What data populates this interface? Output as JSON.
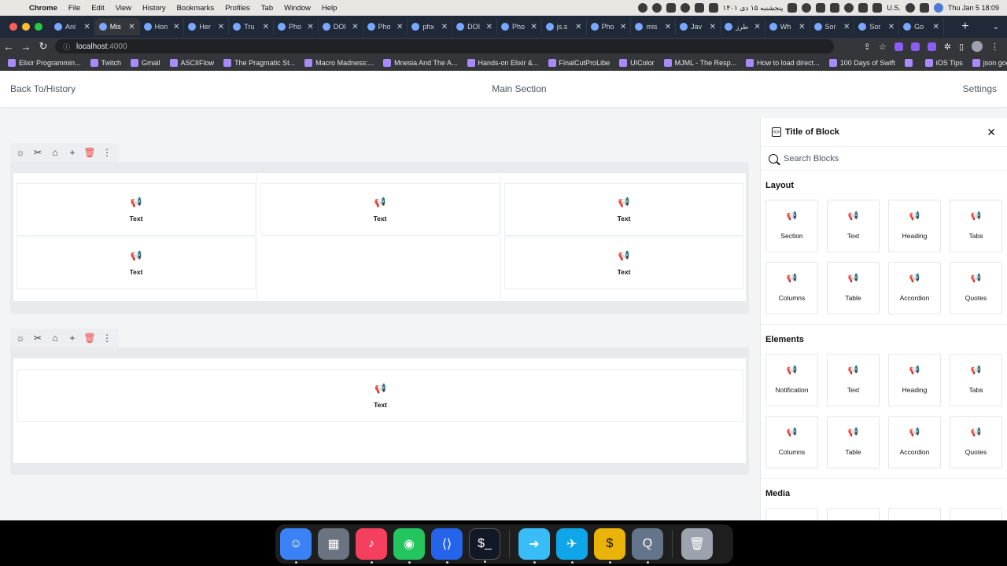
{
  "menubar": {
    "apple": "",
    "items": [
      "Chrome",
      "File",
      "Edit",
      "View",
      "History",
      "Bookmarks",
      "Profiles",
      "Tab",
      "Window",
      "Help"
    ],
    "date_fa": "پنجشنبه ۱۵ دی ۱۴۰۱",
    "input_source": "U.S.",
    "clock": "Thu Jan 5  18:09"
  },
  "tabs": [
    {
      "label": "Ani"
    },
    {
      "label": "Mis"
    },
    {
      "label": "Hon"
    },
    {
      "label": "Her"
    },
    {
      "label": "Tru"
    },
    {
      "label": "Pho"
    },
    {
      "label": "DOI"
    },
    {
      "label": "Pho"
    },
    {
      "label": "phx"
    },
    {
      "label": "DOI"
    },
    {
      "label": "Pho"
    },
    {
      "label": "js.s"
    },
    {
      "label": "Pho"
    },
    {
      "label": "mis"
    },
    {
      "label": "Jav"
    },
    {
      "label": "طرز"
    },
    {
      "label": "Wh"
    },
    {
      "label": "Sor"
    },
    {
      "label": "Sor"
    },
    {
      "label": "Go"
    }
  ],
  "address": {
    "host": "localhost",
    "port": ":4000"
  },
  "bookmarks": [
    "Elixir Programmin...",
    "Twitch",
    "Gmail",
    "ASCIIFlow",
    "The Pragmatic St...",
    "Macro Madness:...",
    "Mnesia And The A...",
    "Hands-on Elixir &...",
    "FinalCutProLibe",
    "UIColor",
    "MJML - The Resp...",
    "How to load direct...",
    "100 Days of Swift",
    "",
    "iOS Tips",
    "json google"
  ],
  "topnav": {
    "back": "Back To/History",
    "center": "Main Section",
    "settings": "Settings"
  },
  "canvas": {
    "section1": {
      "col1": [
        "Text",
        "Text"
      ],
      "col2": [
        "Text"
      ],
      "col3": [
        "Text",
        "Text"
      ]
    },
    "section2": {
      "block": "Text"
    }
  },
  "panel": {
    "title": "Title of Block",
    "search_placeholder": "Search Blocks",
    "groups": [
      {
        "title": "Layout",
        "items": [
          "Section",
          "Text",
          "Heading",
          "Tabs",
          "Columns",
          "Table",
          "Accordion",
          "Quotes"
        ]
      },
      {
        "title": "Elements",
        "items": [
          "Notification",
          "Text",
          "Heading",
          "Tabs",
          "Columns",
          "Table",
          "Accordion",
          "Quotes"
        ]
      },
      {
        "title": "Media",
        "items": []
      }
    ]
  },
  "icons": {
    "block": "megaphone-icon",
    "toolbar": [
      "sun-icon",
      "tools-icon",
      "tag-icon",
      "plus-icon",
      "trash-icon",
      "more-vertical-icon"
    ]
  },
  "colors": {
    "danger": "#ef4444",
    "page_bg": "#f3f4f6",
    "section_bg": "#e8eaed"
  }
}
